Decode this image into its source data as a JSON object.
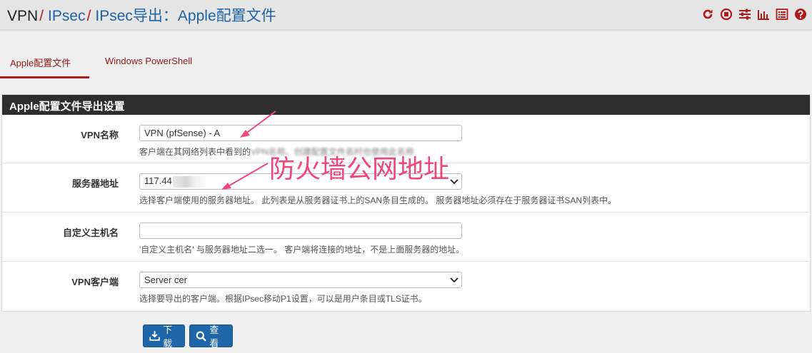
{
  "breadcrumb": {
    "root": "VPN",
    "level2": "IPsec",
    "level3": "IPsec导出：Apple配置文件",
    "separator": "/"
  },
  "header_icons": [
    "reload-icon",
    "stop-icon",
    "sliders-icon",
    "chart-icon",
    "list-icon",
    "help-icon"
  ],
  "colors": {
    "accent_red": "#b01a1a",
    "link_blue": "#1e63a8",
    "button_blue": "#1f66a9",
    "annotation_pink": "#f0467a"
  },
  "tabs": [
    {
      "label": "Apple配置文件",
      "active": true
    },
    {
      "label": "Windows PowerShell",
      "active": false
    }
  ],
  "panel": {
    "title": "Apple配置文件导出设置",
    "rows": {
      "vpn_name": {
        "label": "VPN名称",
        "value": "VPN (pfSense) - A",
        "help_visible": "客户端在其网络列表中看到的",
        "help_obscured": "VPN名称。创建配置文件名时也使用此名称"
      },
      "server": {
        "label": "服务器地址",
        "value": "117.44",
        "help": "选择客户端使用的服务器地址。 此列表是从服务器证书上的SAN条目生成的。 服务器地址必须存在于服务器证书SAN列表中。"
      },
      "custom_host": {
        "label": "自定义主机名",
        "value": "",
        "help": "'自定义主机名' 与服务器地址二选一。 客户端将连接的地址，不是上面服务器的地址。"
      },
      "vpn_client": {
        "label": "VPN客户端",
        "value": "Server cer",
        "help": "选择要导出的客户端。根据IPsec移动P1设置，可以是用户条目或TLS证书。"
      }
    }
  },
  "buttons": {
    "download": "下载",
    "view": "查看"
  },
  "annotation": {
    "text": "防火墙公网地址"
  }
}
